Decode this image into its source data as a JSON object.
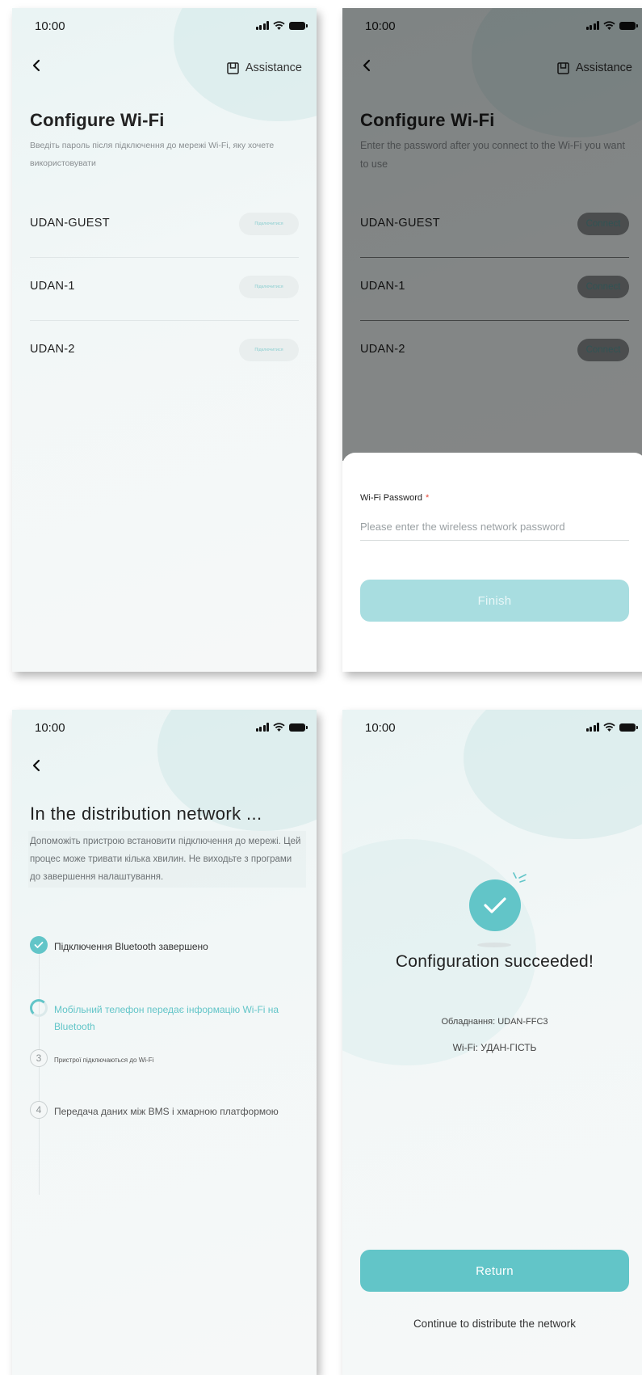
{
  "status_time": "10:00",
  "colors": {
    "accent": "#62c5c8",
    "accent_light": "#a8dde0",
    "required": "#e4483a"
  },
  "screen1": {
    "assistance": "Assistance",
    "title": "Configure Wi-Fi",
    "subtitle": "Введіть пароль після підключення до мережі Wi-Fi, яку хочете використовувати",
    "networks": [
      {
        "name": "UDAN-GUEST",
        "connect": "Підключитися"
      },
      {
        "name": "UDAN-1",
        "connect": "Підключитися"
      },
      {
        "name": "UDAN-2",
        "connect": "Підключитися"
      }
    ]
  },
  "screen2": {
    "assistance": "Assistance",
    "title": "Configure Wi-Fi",
    "subtitle": "Enter the password after you connect to the Wi-Fi you want to use",
    "networks": [
      {
        "name": "UDAN-GUEST",
        "connect": "Connect"
      },
      {
        "name": "UDAN-1",
        "connect": "Connect"
      },
      {
        "name": "UDAN-2",
        "connect": "Connect"
      }
    ],
    "password_label": "Wi-Fi Password",
    "required_mark": "*",
    "password_placeholder": "Please enter the wireless network password",
    "finish": "Finish"
  },
  "screen3": {
    "title": "In the distribution network ...",
    "subtitle": "Допоможіть пристрою встановити підключення до мережі. Цей процес може тривати кілька хвилин. Не виходьте з програми до завершення налаштування.",
    "steps": [
      {
        "state": "done",
        "text": "Підключення Bluetooth завершено"
      },
      {
        "state": "active",
        "text": "Мобільний телефон передає інформацію Wi-Fi на Bluetooth"
      },
      {
        "state": "pending",
        "num": "3",
        "text": "Пристрої підключаються до Wi-Fi"
      },
      {
        "state": "pending",
        "num": "4",
        "text": "Передача даних між BMS і хмарною платформою"
      }
    ]
  },
  "screen4": {
    "title": "Configuration succeeded!",
    "device": "Обладнання: UDAN-FFC3",
    "wifi": "Wi-Fi: УДАН-ГІСТЬ",
    "return": "Return",
    "continue": "Continue to distribute the network"
  }
}
